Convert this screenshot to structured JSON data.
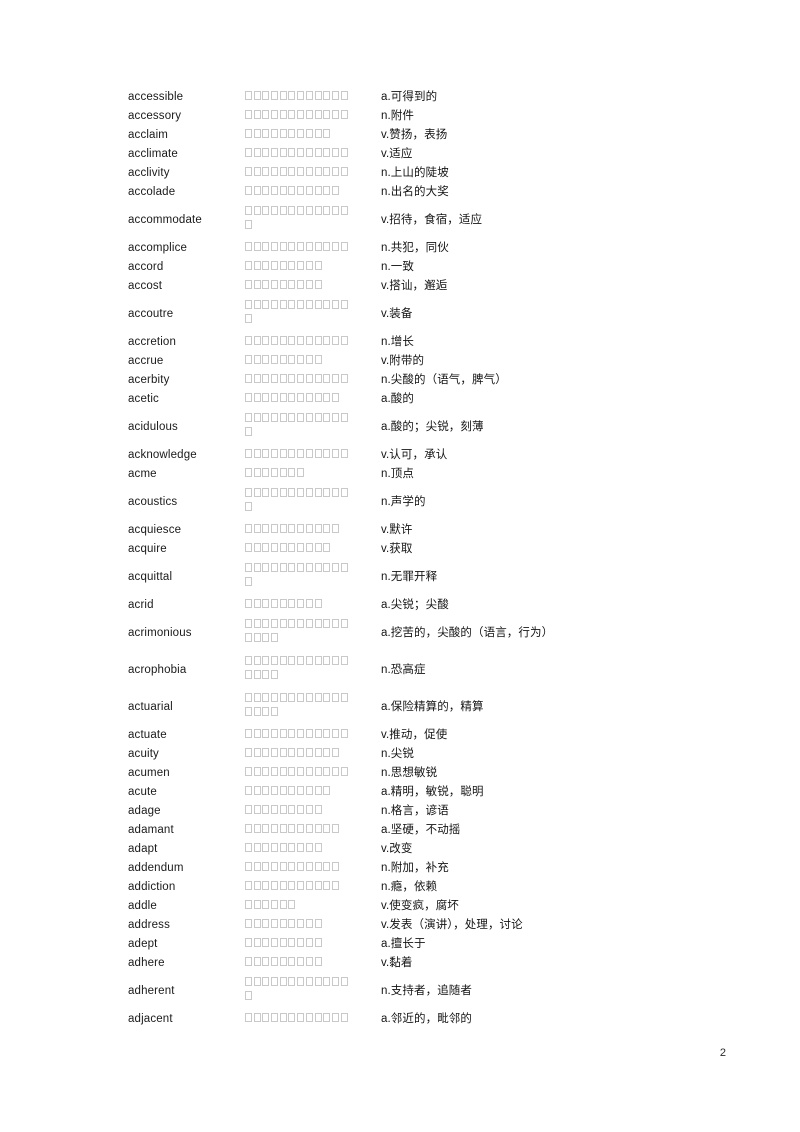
{
  "document": {
    "page_number": "2",
    "columns": [
      "word",
      "phonetic",
      "definition"
    ]
  },
  "entries": [
    {
      "word": "accessible",
      "phonetic_boxes": 12,
      "definition": "a.可得到的"
    },
    {
      "word": "accessory",
      "phonetic_boxes": 12,
      "definition": "n.附件"
    },
    {
      "word": "acclaim",
      "phonetic_boxes": 10,
      "definition": "v.赞扬，表扬"
    },
    {
      "word": "acclimate",
      "phonetic_boxes": 12,
      "definition": "v.适应"
    },
    {
      "word": "acclivity",
      "phonetic_boxes": 12,
      "definition": "n.上山的陡坡"
    },
    {
      "word": "accolade",
      "phonetic_boxes": 11,
      "definition": "n.出名的大奖"
    },
    {
      "word": "accommodate",
      "phonetic_boxes": 13,
      "definition": "v.招待，食宿，适应"
    },
    {
      "word": "accomplice",
      "phonetic_boxes": 12,
      "definition": "n.共犯，同伙"
    },
    {
      "word": "accord",
      "phonetic_boxes": 9,
      "definition": "n.一致"
    },
    {
      "word": "accost",
      "phonetic_boxes": 9,
      "definition": "v.搭讪，邂逅"
    },
    {
      "word": "accoutre",
      "phonetic_boxes": 13,
      "definition": "v.装备"
    },
    {
      "word": "accretion",
      "phonetic_boxes": 12,
      "definition": "n.增长"
    },
    {
      "word": "accrue",
      "phonetic_boxes": 9,
      "definition": "v.附带的"
    },
    {
      "word": "acerbity",
      "phonetic_boxes": 12,
      "definition": "n.尖酸的（语气，脾气）"
    },
    {
      "word": "acetic",
      "phonetic_boxes": 11,
      "definition": "a.酸的"
    },
    {
      "word": "acidulous",
      "phonetic_boxes": 13,
      "definition": "a.酸的；尖锐，刻薄"
    },
    {
      "word": "acknowledge",
      "phonetic_boxes": 12,
      "definition": "v.认可，承认"
    },
    {
      "word": "acme",
      "phonetic_boxes": 7,
      "definition": "n.顶点"
    },
    {
      "word": "acoustics",
      "phonetic_boxes": 13,
      "definition": "n.声学的"
    },
    {
      "word": "acquiesce",
      "phonetic_boxes": 11,
      "definition": "v.默许"
    },
    {
      "word": "acquire",
      "phonetic_boxes": 10,
      "definition": "v.获取"
    },
    {
      "word": "acquittal",
      "phonetic_boxes": 13,
      "definition": "n.无罪开释"
    },
    {
      "word": "acrid",
      "phonetic_boxes": 9,
      "definition": "a.尖锐；尖酸"
    },
    {
      "word": "acrimonious",
      "phonetic_boxes": 16,
      "definition": "a.挖苦的，尖酸的（语言，行为）"
    },
    {
      "word": "acrophobia",
      "phonetic_boxes": 16,
      "definition": "n.恐高症"
    },
    {
      "word": "actuarial",
      "phonetic_boxes": 16,
      "definition": "a.保险精算的，精算"
    },
    {
      "word": "actuate",
      "phonetic_boxes": 12,
      "definition": "v.推动，促使"
    },
    {
      "word": "acuity",
      "phonetic_boxes": 11,
      "definition": "n.尖锐"
    },
    {
      "word": "acumen",
      "phonetic_boxes": 12,
      "definition": "n.思想敏锐"
    },
    {
      "word": "acute",
      "phonetic_boxes": 10,
      "definition": "a.精明，敏锐，聪明"
    },
    {
      "word": "adage",
      "phonetic_boxes": 9,
      "definition": "n.格言，谚语"
    },
    {
      "word": "adamant",
      "phonetic_boxes": 11,
      "definition": "a.坚硬，不动摇"
    },
    {
      "word": "adapt",
      "phonetic_boxes": 9,
      "definition": "v.改变"
    },
    {
      "word": "addendum",
      "phonetic_boxes": 11,
      "definition": "n.附加，补充"
    },
    {
      "word": "addiction",
      "phonetic_boxes": 11,
      "definition": "n.瘾，依赖"
    },
    {
      "word": "addle",
      "phonetic_boxes": 6,
      "definition": "v.使变疯，腐坏"
    },
    {
      "word": "address",
      "phonetic_boxes": 9,
      "definition": "v.发表（演讲），处理，讨论"
    },
    {
      "word": "adept",
      "phonetic_boxes": 9,
      "definition": "a.擅长于"
    },
    {
      "word": "adhere",
      "phonetic_boxes": 9,
      "definition": "v.黏着"
    },
    {
      "word": "adherent",
      "phonetic_boxes": 13,
      "definition": "n.支持者，追随者"
    },
    {
      "word": "adjacent",
      "phonetic_boxes": 12,
      "definition": "a.邻近的，毗邻的"
    }
  ]
}
